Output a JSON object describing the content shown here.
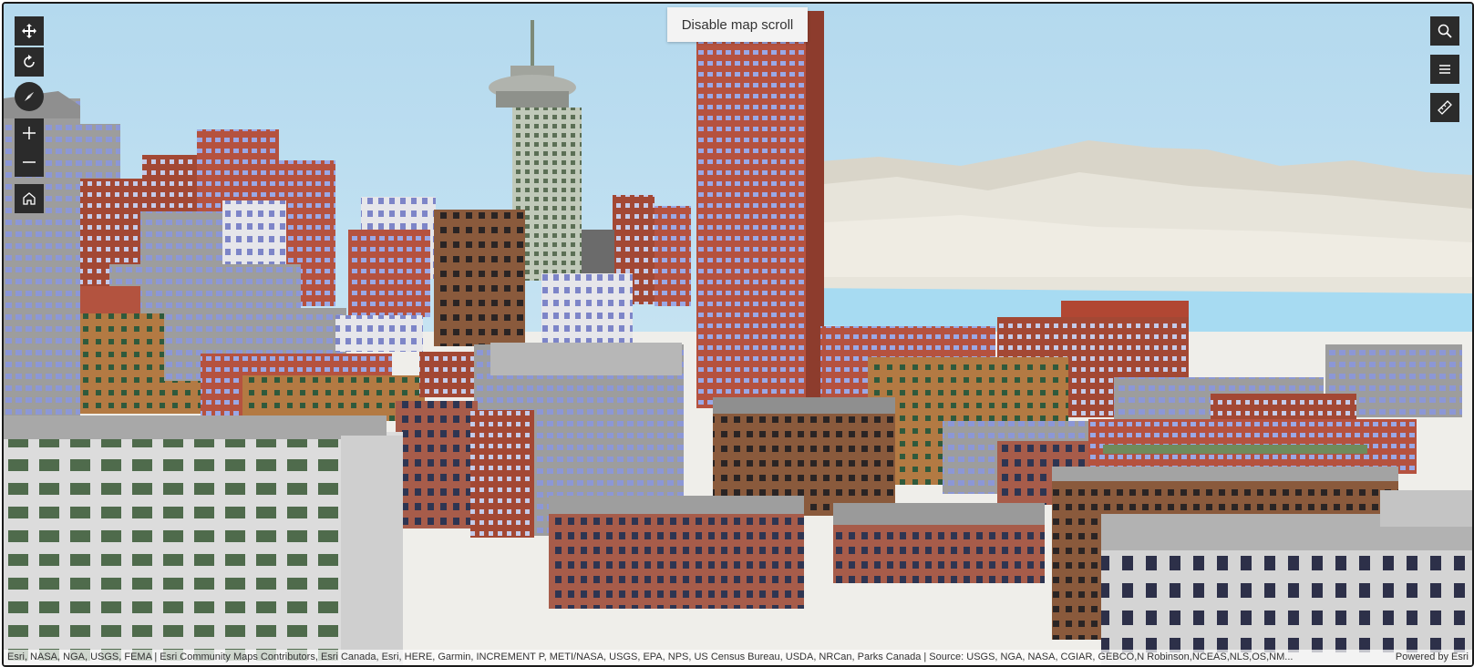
{
  "map": {
    "disable_scroll_label": "Disable map scroll",
    "attribution": "Esri, NASA, NGA, USGS, FEMA | Esri Community Maps Contributors, Esri Canada, Esri, HERE, Garmin, INCREMENT P, METI/NASA, USGS, EPA, NPS, US Census Bureau, USDA, NRCan, Parks Canada | Source: USGS, NGA, NASA, CGIAR, GEBCO,N Robinson,NCEAS,NLS,OS,NM...",
    "powered_by": "Powered by Esri"
  },
  "controls": {
    "left": [
      "pan-icon",
      "rotate-icon",
      "compass-icon",
      "plus-icon",
      "minus-icon",
      "home-icon"
    ],
    "right": [
      "search-icon",
      "layer-list-icon",
      "measure-icon"
    ]
  },
  "colors": {
    "control_bg": "#2b2b2b",
    "sky": "#bcdff0",
    "water": "#a7dbf2",
    "ground": "#efeeea"
  }
}
